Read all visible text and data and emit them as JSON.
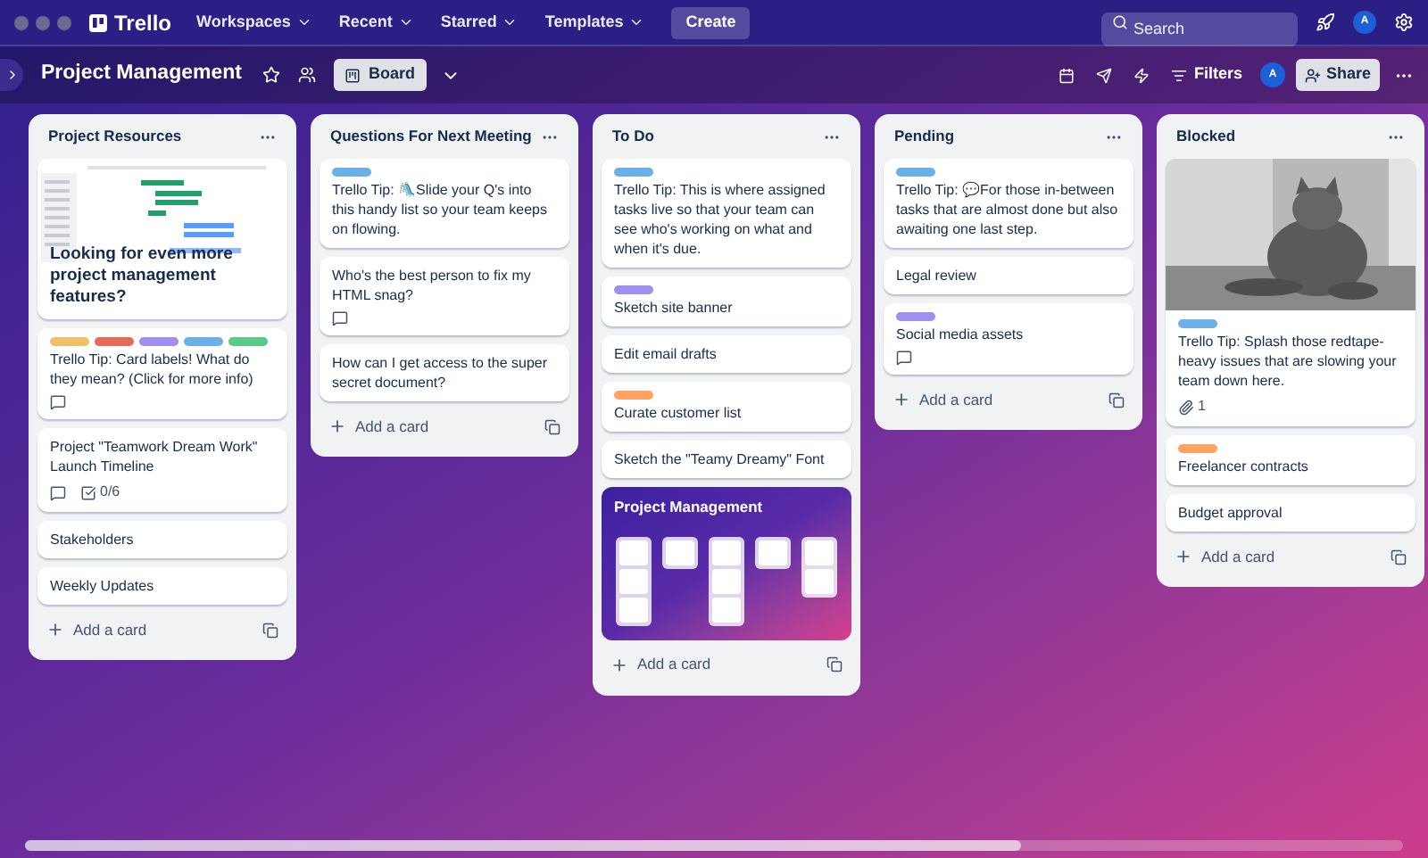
{
  "topbar": {
    "logo": "Trello",
    "menus": [
      "Workspaces",
      "Recent",
      "Starred",
      "Templates"
    ],
    "create": "Create",
    "search": {
      "placeholder": "Search"
    },
    "avatar": "A"
  },
  "board": {
    "title": "Project Management",
    "view": "Board",
    "filters": "Filters",
    "avatar": "A",
    "share": "Share"
  },
  "lists": [
    {
      "title": "Project Resources",
      "add": "Add a card",
      "cards": [
        {
          "kind": "cover",
          "text": "Looking for even more project management features?"
        },
        {
          "kind": "text",
          "labels": [
            {
              "color": "#f0c068"
            },
            {
              "color": "#e56a5a"
            },
            {
              "color": "#9f8fef"
            },
            {
              "color": "#6cb0e8"
            },
            {
              "color": "#5cc98a"
            }
          ],
          "text": "Trello Tip: Card labels! What do they mean? (Click for more info)",
          "comments": true
        },
        {
          "kind": "text",
          "text": "Project \"Teamwork Dream Work\" Launch Timeline",
          "comments": true,
          "checklist": "0/6"
        },
        {
          "kind": "text",
          "text": "Stakeholders"
        },
        {
          "kind": "text",
          "text": "Weekly Updates"
        }
      ]
    },
    {
      "title": "Questions For Next Meeting",
      "add": "Add a card",
      "cards": [
        {
          "kind": "text",
          "labels": [
            {
              "color": "#6cb0e8"
            }
          ],
          "text": "Trello Tip: 🛝Slide your Q's into this handy list so your team keeps on flowing."
        },
        {
          "kind": "text",
          "text": "Who's the best person to fix my HTML snag?",
          "comments": true
        },
        {
          "kind": "text",
          "text": "How can I get access to the super secret document?"
        }
      ]
    },
    {
      "title": "To Do",
      "add": "Add a card",
      "cards": [
        {
          "kind": "text",
          "labels": [
            {
              "color": "#6cb0e8"
            }
          ],
          "text": "Trello Tip: This is where assigned tasks live so that your team can see who's working on what and when it's due."
        },
        {
          "kind": "text",
          "labels": [
            {
              "color": "#9f8fef"
            }
          ],
          "text": "Sketch site banner"
        },
        {
          "kind": "text",
          "text": "Edit email drafts"
        },
        {
          "kind": "text",
          "labels": [
            {
              "color": "#fea362"
            }
          ],
          "text": "Curate customer list"
        },
        {
          "kind": "text",
          "text": "Sketch the \"Teamy Dreamy\" Font"
        },
        {
          "kind": "template",
          "text": "Project Management"
        }
      ]
    },
    {
      "title": "Pending",
      "add": "Add a card",
      "cards": [
        {
          "kind": "text",
          "labels": [
            {
              "color": "#6cb0e8"
            }
          ],
          "text": "Trello Tip: 💬For those in-between tasks that are almost done but also awaiting one last step."
        },
        {
          "kind": "text",
          "text": "Legal review"
        },
        {
          "kind": "text",
          "labels": [
            {
              "color": "#9f8fef"
            }
          ],
          "text": "Social media assets",
          "comments": true
        }
      ]
    },
    {
      "title": "Blocked",
      "add": "Add a card",
      "cards": [
        {
          "labels": [
            {
              "color": "#6cb0e8"
            }
          ],
          "text": "Trello Tip: Splash those redtape-heavy issues that are slowing your team down here.",
          "attachments": "1"
        },
        {
          "kind": "text",
          "labels": [
            {
              "color": "#fea362"
            }
          ],
          "text": "Freelancer contracts"
        },
        {
          "kind": "text",
          "text": "Budget approval"
        }
      ]
    }
  ]
}
